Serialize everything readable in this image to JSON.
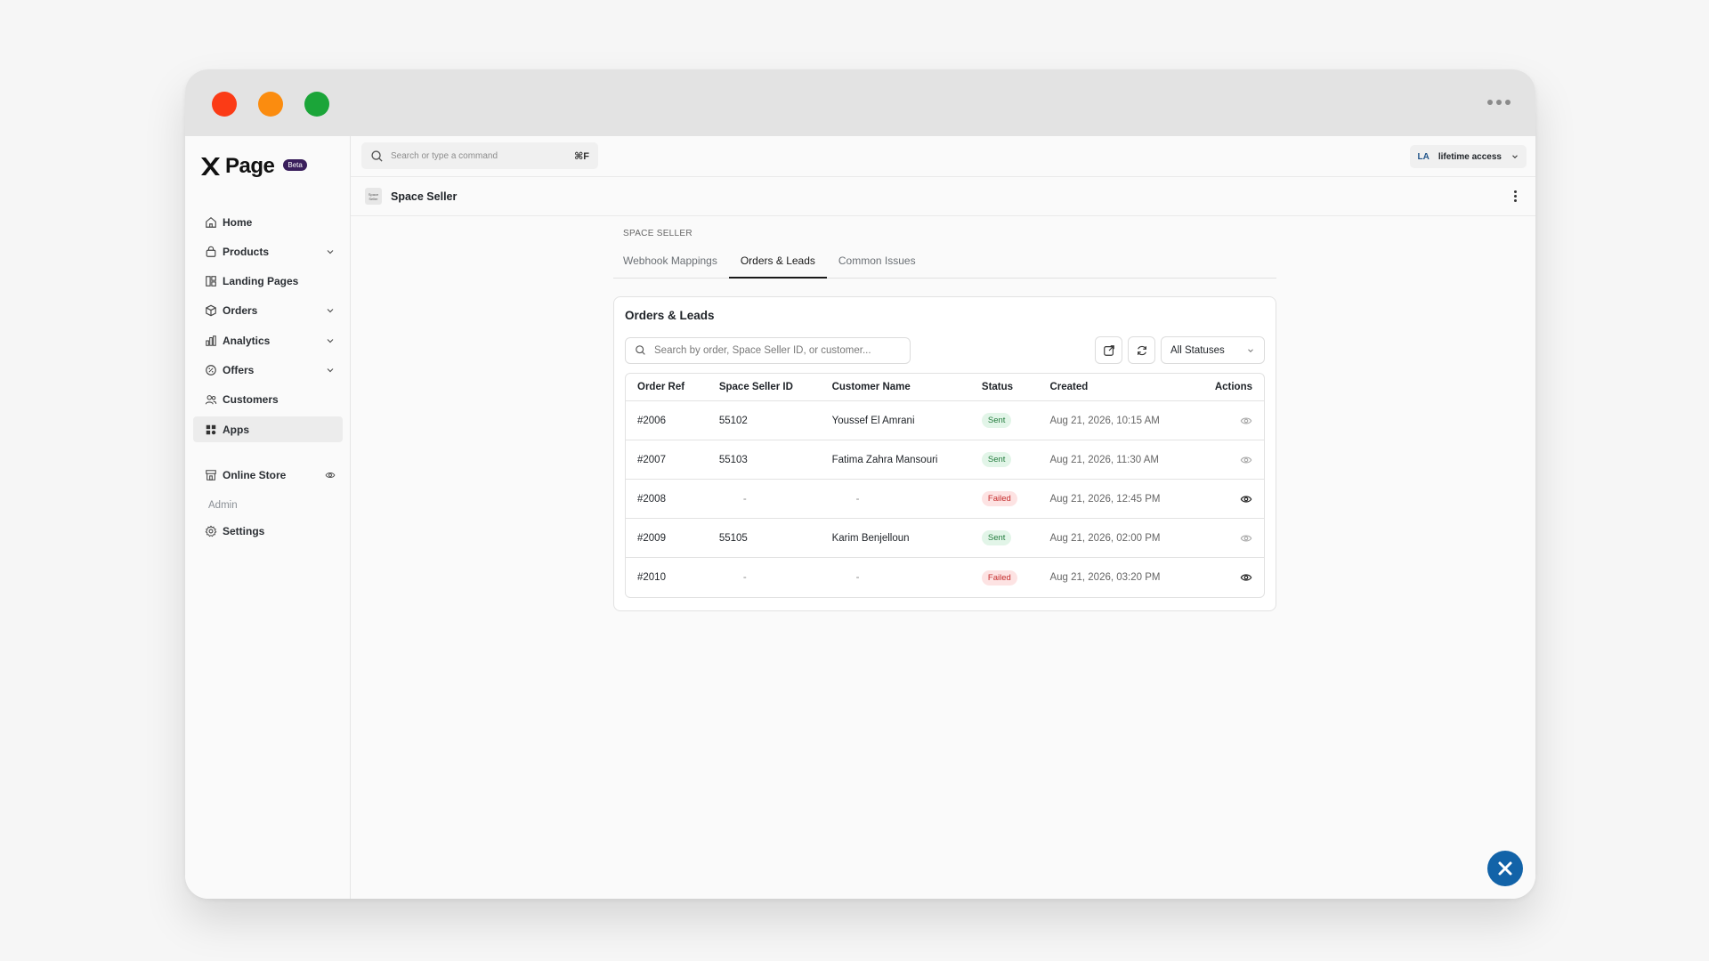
{
  "window": {
    "traffic_lights": [
      "close",
      "minimize",
      "zoom"
    ],
    "more_icon": "more-horizontal-icon"
  },
  "brand": {
    "name": "Page",
    "badge": "Beta"
  },
  "sidebar": {
    "items": [
      {
        "label": "Home",
        "icon": "home-icon",
        "has_chevron": false
      },
      {
        "label": "Products",
        "icon": "lock-bag-icon",
        "has_chevron": true
      },
      {
        "label": "Landing Pages",
        "icon": "layout-icon",
        "has_chevron": false
      },
      {
        "label": "Orders",
        "icon": "box-icon",
        "has_chevron": true
      },
      {
        "label": "Analytics",
        "icon": "bar-chart-icon",
        "has_chevron": true
      },
      {
        "label": "Offers",
        "icon": "percent-badge-icon",
        "has_chevron": true
      },
      {
        "label": "Customers",
        "icon": "users-icon",
        "has_chevron": false
      },
      {
        "label": "Apps",
        "icon": "apps-grid-icon",
        "has_chevron": false,
        "active": true
      }
    ],
    "online_store": {
      "label": "Online Store",
      "icon": "store-icon",
      "trailing_icon": "eye-icon"
    },
    "admin_section": "Admin",
    "settings": {
      "label": "Settings",
      "icon": "gear-icon"
    }
  },
  "topbar": {
    "search_placeholder": "Search or type a command",
    "shortcut": "⌘F",
    "account_initials": "LA",
    "account_plan": "lifetime access"
  },
  "subbar": {
    "app_name": "Space Seller",
    "thumb_text": "Space Seller"
  },
  "page": {
    "eyebrow": "SPACE SELLER",
    "tabs": [
      {
        "label": "Webhook Mappings",
        "active": false
      },
      {
        "label": "Orders & Leads",
        "active": true
      },
      {
        "label": "Common Issues",
        "active": false
      }
    ]
  },
  "card": {
    "title": "Orders & Leads",
    "search_placeholder": "Search by order, Space Seller ID, or customer...",
    "status_filter": "All Statuses",
    "columns": [
      "Order Ref",
      "Space Seller ID",
      "Customer Name",
      "Status",
      "Created",
      "Actions"
    ],
    "rows": [
      {
        "ref": "#2006",
        "seller_id": "55102",
        "customer": "Youssef El Amrani",
        "status": "Sent",
        "created": "Aug 21, 2026, 10:15 AM"
      },
      {
        "ref": "#2007",
        "seller_id": "55103",
        "customer": "Fatima Zahra Mansouri",
        "status": "Sent",
        "created": "Aug 21, 2026, 11:30 AM"
      },
      {
        "ref": "#2008",
        "seller_id": "-",
        "customer": "-",
        "status": "Failed",
        "created": "Aug 21, 2026, 12:45 PM"
      },
      {
        "ref": "#2009",
        "seller_id": "55105",
        "customer": "Karim Benjelloun",
        "status": "Sent",
        "created": "Aug 21, 2026, 02:00 PM"
      },
      {
        "ref": "#2010",
        "seller_id": "-",
        "customer": "-",
        "status": "Failed",
        "created": "Aug 21, 2026, 03:20 PM"
      }
    ]
  },
  "colors": {
    "accent": "#1263a8",
    "sent_bg": "#e2f5e8",
    "failed_bg": "#fde3e3"
  }
}
